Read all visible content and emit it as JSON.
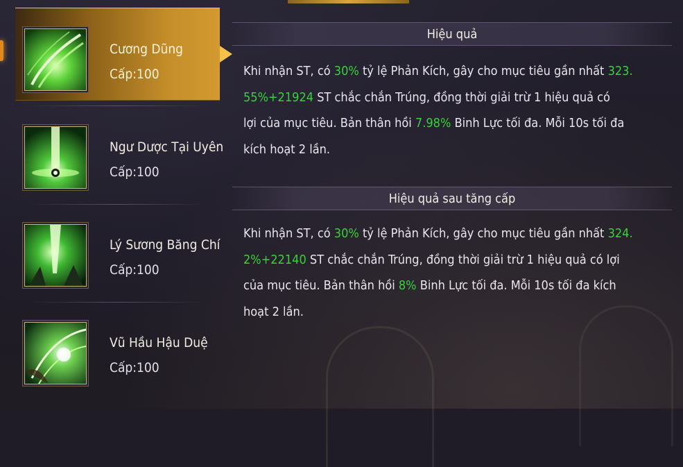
{
  "skills": [
    {
      "name": "Cương Dũng",
      "level": "Cấp:100",
      "active": true
    },
    {
      "name": "Ngư Dược Tại Uyên",
      "level": "Cấp:100",
      "active": false
    },
    {
      "name": "Lý Sương Băng Chí",
      "level": "Cấp:100",
      "active": false
    },
    {
      "name": "Vũ Hầu Hậu Duệ",
      "level": "Cấp:100",
      "active": false
    }
  ],
  "effect": {
    "title": "Hiệu quả",
    "segments": [
      {
        "text": "Khi nhận ST, có ",
        "hl": false
      },
      {
        "text": "30%",
        "hl": true
      },
      {
        "text": " tỷ lệ Phản Kích, gây cho mục tiêu gần nhất ",
        "hl": false
      },
      {
        "text": "323.\n55%+21924",
        "hl": true
      },
      {
        "text": " ST chắc chắn Trúng, đồng thời giải trừ 1 hiệu quả có\nlợi của mục tiêu. Bản thân hồi ",
        "hl": false
      },
      {
        "text": "7.98%",
        "hl": true
      },
      {
        "text": " Binh Lực tối đa. Mỗi 10s tối đa\nkích hoạt 2 lần.",
        "hl": false
      }
    ]
  },
  "upgrade": {
    "title": "Hiệu quả sau tăng cấp",
    "segments": [
      {
        "text": "Khi nhận ST, có ",
        "hl": false
      },
      {
        "text": "30%",
        "hl": true
      },
      {
        "text": " tỷ lệ Phản Kích, gây cho mục tiêu gần nhất ",
        "hl": false
      },
      {
        "text": "324.\n2%+22140",
        "hl": true
      },
      {
        "text": " ST chắc chắn Trúng, đồng thời giải trừ 1 hiệu quả có lợi\ncủa mục tiêu. Bản thân hồi ",
        "hl": false
      },
      {
        "text": "8%",
        "hl": true
      },
      {
        "text": " Binh Lực tối đa. Mỗi 10s tối đa kích\nhoạt 2 lần.",
        "hl": false
      }
    ]
  },
  "colors": {
    "highlight": "#38d13a",
    "accent": "#d49a30"
  },
  "icons": [
    "wind-slash-icon",
    "green-beam-icon",
    "ice-spear-icon",
    "feather-burst-icon"
  ]
}
